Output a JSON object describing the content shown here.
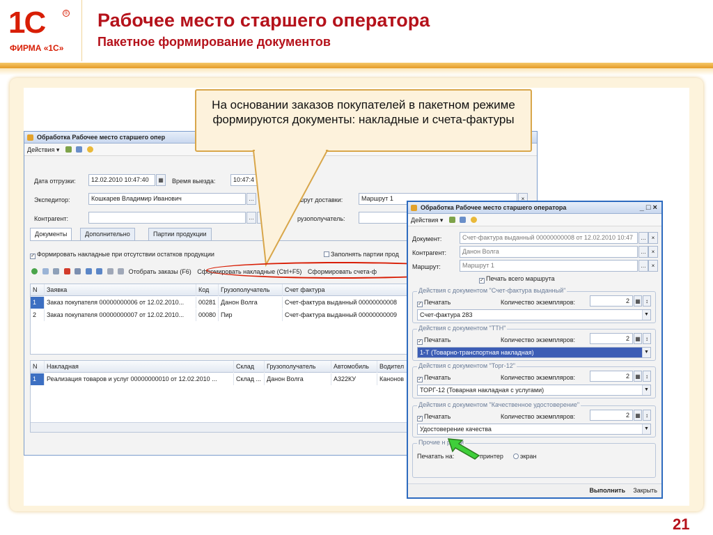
{
  "slide": {
    "logo": {
      "mark": "1С",
      "registered": "®",
      "company": "ФИРМА «1С»"
    },
    "title": "Рабочее место старшего оператора",
    "subtitle": "Пакетное формирование документов",
    "page_number": "21",
    "callout": "На основании заказов покупателей в пакетном режиме формируются документы: накладные и счета-фактуры"
  },
  "main_window": {
    "title": "Обработка  Рабочее место старшего опер",
    "menu": {
      "actions": "Действия ▾"
    },
    "fields": {
      "ship_date_label": "Дата отгрузки:",
      "ship_date_value": "12.02.2010 10:47:40",
      "depart_time_label": "Время выезда:",
      "depart_time_value": "10:47:4",
      "forwarder_label": "Экспедитор:",
      "forwarder_value": "Кошкарев Владимир Иванович",
      "route_label": "шрут доставки:",
      "route_value": "Маршрут 1",
      "counterparty_label": "Контрагент:",
      "consignee_label": "рузополучатель:"
    },
    "tabs": [
      "Документы",
      "Дополнительно",
      "Партии продукции"
    ],
    "checkbox_form_invoices": "Формировать накладные при отсутствии остатков продукции",
    "checkbox_fill_batches": "Заполнять партии прод",
    "toolbar": {
      "select_orders": "Отобрать заказы (F6)",
      "form_invoices": "Сформировать накладные (Ctrl+F5)",
      "form_facturas": "Сформировать счета-ф"
    },
    "orders_table": {
      "headers": [
        "N",
        "Заявка",
        "Код",
        "Грузополучатель",
        "Счет фактура"
      ],
      "rows": [
        [
          "1",
          "Заказ покупателя 00000000006 от 12.02.2010...",
          "00281",
          "Данон Волга",
          "Счет-фактура выданный 00000000008"
        ],
        [
          "2",
          "Заказ покупателя 00000000007 от 12.02.2010...",
          "00080",
          "Пир",
          "Счет-фактура выданный 00000000009"
        ]
      ]
    },
    "invoices_table": {
      "headers": [
        "N",
        "Накладная",
        "Склад",
        "Грузополучатель",
        "Автомобиль",
        "Водител"
      ],
      "rows": [
        [
          "1",
          "Реализация товаров и услуг 00000000010 от 12.02.2010 ...",
          "Склад ...",
          "Данон Волга",
          "А322КУ",
          "Канонов"
        ]
      ]
    }
  },
  "print_window": {
    "title": "Обработка  Рабочее место старшего оператора",
    "menu": {
      "actions": "Действия ▾"
    },
    "document_label": "Документ:",
    "document_value": "Счет-фактура выданный 00000000008 от 12.02.2010 10:47",
    "counterparty_label": "Контрагент:",
    "counterparty_value": "Данон Волга",
    "route_label": "Маршрут:",
    "route_value": "Маршрут 1",
    "print_route": "Печать всего маршрута",
    "groups": [
      {
        "title": "Действия с документом \"Счет-фактура выданный\"",
        "print": "Печатать",
        "copies_label": "Количество экземпляров:",
        "copies": "2",
        "form": "Счет-фактура 283"
      },
      {
        "title": "Действия с документом \"ТТН\"",
        "print": "Печатать",
        "copies_label": "Количество экземпляров:",
        "copies": "2",
        "form": "1-Т (Товарно-транспортная накладная)"
      },
      {
        "title": "Действия с документом \"Торг-12\"",
        "print": "Печатать",
        "copies_label": "Количество экземпляров:",
        "copies": "2",
        "form": "ТОРГ-12 (Товарная накладная с услугами)"
      },
      {
        "title": "Действия с документом \"Качественное удостоверение\"",
        "print": "Печатать",
        "copies_label": "Количество экземпляров:",
        "copies": "2",
        "form": "Удостоверение качества"
      }
    ],
    "other_settings": {
      "title": "Прочие н     ройки",
      "print_to": "Печатать на:",
      "printer": "принтер",
      "screen": "экран"
    },
    "buttons": {
      "execute": "Выполнить",
      "close": "Закрыть"
    },
    "window_controls": "_ □ ×"
  }
}
